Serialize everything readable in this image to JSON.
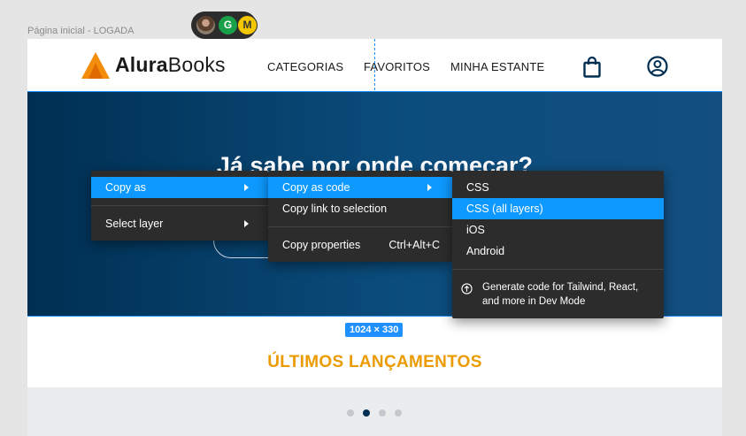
{
  "frame": {
    "label": "Página inicial - LOGADA"
  },
  "collaborators": [
    {
      "name": "photo-avatar",
      "initial": ""
    },
    {
      "name": "G",
      "initial": "G",
      "color": "#1aa04a"
    },
    {
      "name": "M",
      "initial": "M",
      "color": "#f4c800"
    }
  ],
  "site": {
    "logo": {
      "bold": "Alura",
      "light": "Books",
      "color": "#f48c0c"
    },
    "nav": [
      "CATEGORIAS",
      "FAVORITOS",
      "MINHA ESTANTE"
    ],
    "hero_title": "Já sabe por onde começar?",
    "section_title": "ÚLTIMOS LANÇAMENTOS",
    "carousel": {
      "dots": 4,
      "active": 2
    }
  },
  "selection": {
    "size": "1024 × 330"
  },
  "menus": {
    "level1": {
      "items": [
        {
          "label": "Copy as"
        },
        {
          "label": "Select layer"
        }
      ]
    },
    "level2": {
      "items": [
        {
          "label": "Copy as code"
        },
        {
          "label": "Copy link to selection"
        },
        {
          "label": "Copy properties",
          "shortcut": "Ctrl+Alt+C"
        }
      ]
    },
    "level3": {
      "items": [
        {
          "label": "CSS"
        },
        {
          "label": "CSS (all layers)"
        },
        {
          "label": "iOS"
        },
        {
          "label": "Android"
        }
      ],
      "footer": "Generate code for Tailwind, React, and more in Dev Mode"
    }
  },
  "colors": {
    "accent": "#0d99ff",
    "hero": "#002f52",
    "title": "#eb9b00"
  }
}
